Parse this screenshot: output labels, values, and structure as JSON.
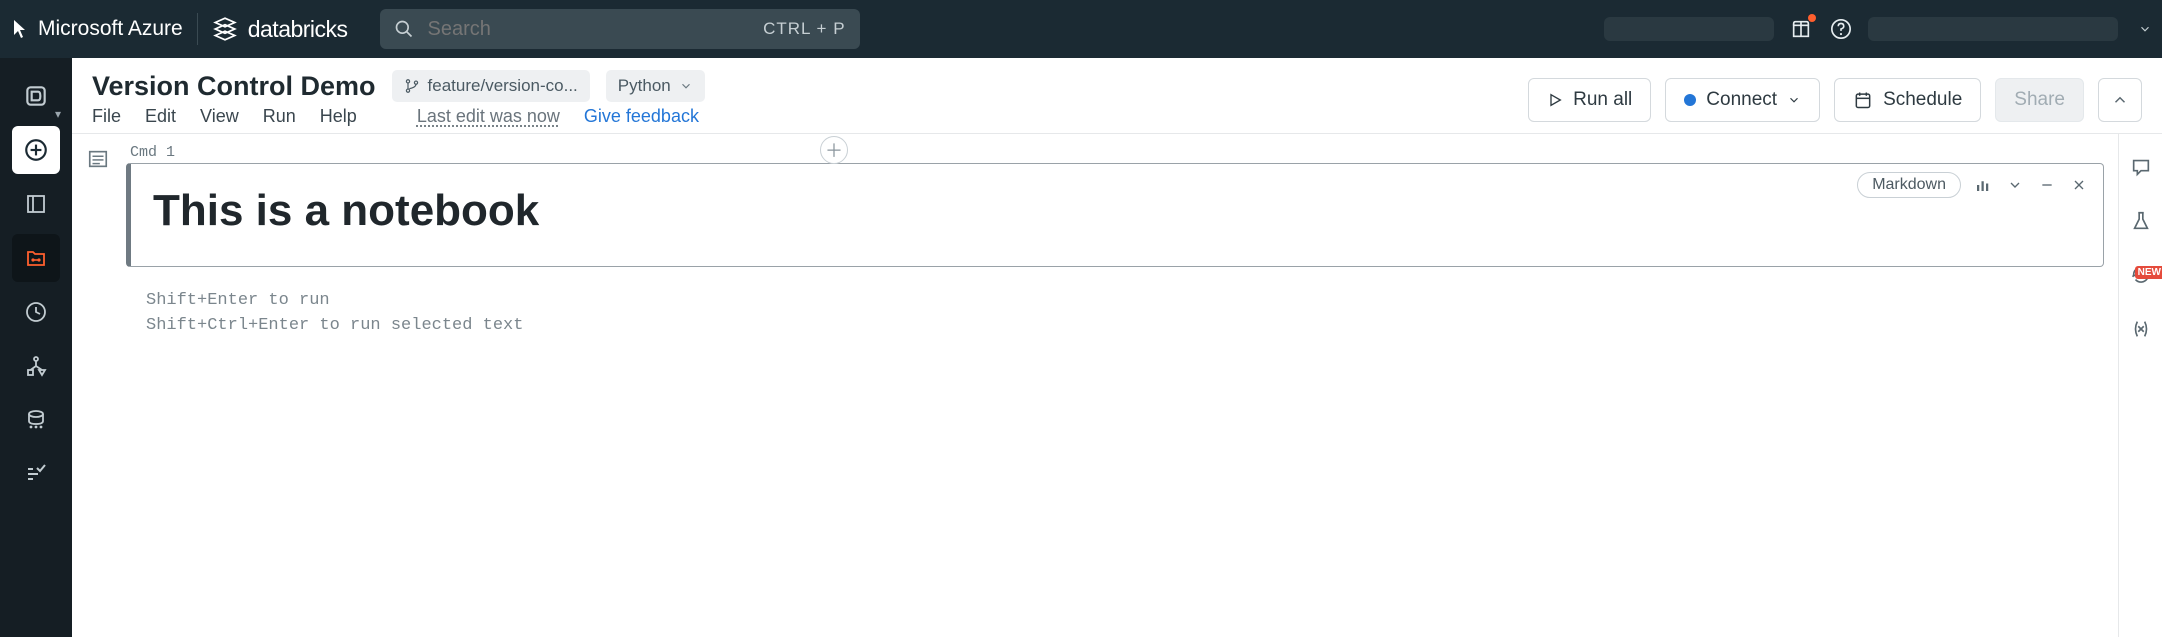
{
  "topbar": {
    "cloud_provider": "Microsoft Azure",
    "product_name": "databricks",
    "search_placeholder": "Search",
    "search_shortcut": "CTRL + P"
  },
  "notebook": {
    "title": "Version Control Demo",
    "branch_label": "feature/version-co...",
    "language_label": "Python",
    "menus": {
      "file": "File",
      "edit": "Edit",
      "view": "View",
      "run": "Run",
      "help": "Help"
    },
    "last_edit": "Last edit was now",
    "feedback": "Give feedback"
  },
  "actions": {
    "run_all": "Run all",
    "connect": "Connect",
    "schedule": "Schedule",
    "share": "Share"
  },
  "cell": {
    "cmd_label": "Cmd 1",
    "language_pill": "Markdown",
    "heading_text": "This is a notebook"
  },
  "hints": {
    "line1": "Shift+Enter to run",
    "line2": "Shift+Ctrl+Enter to run selected text"
  },
  "right_rail": {
    "new_badge": "NEW"
  }
}
